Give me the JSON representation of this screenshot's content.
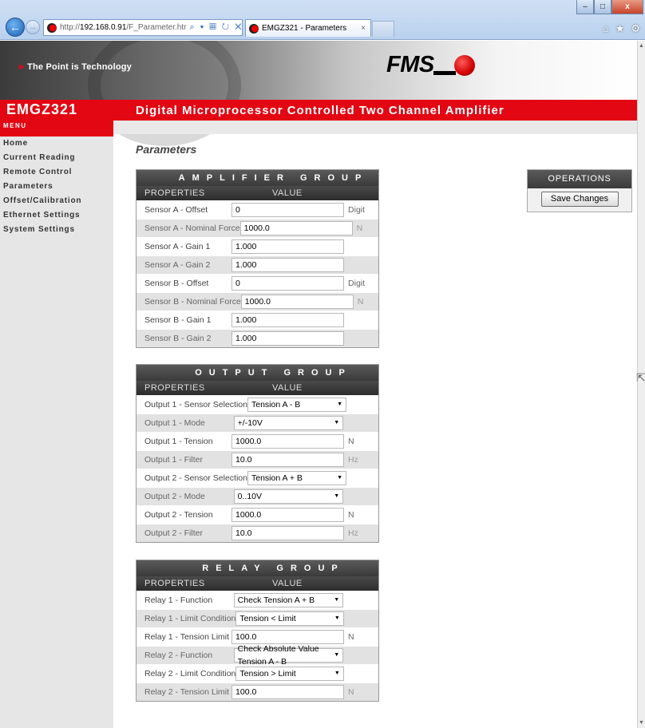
{
  "browser": {
    "url_prefix": "http://",
    "url_host": "192.168.0.91",
    "url_path": "/F_Parameter.htr",
    "address_icons": "⌕ ▾ ▦ ↻ ✕",
    "tab_title": "EMGZ321 - Parameters",
    "tab_close": "×",
    "win_min": "–",
    "win_max": "□",
    "win_close": "x",
    "toolbar_icons": [
      "⌂",
      "★",
      "⚙"
    ]
  },
  "header": {
    "tagline": "The Point is Technology",
    "logo_text": "FMS",
    "product": "EMGZ321",
    "subtitle": "Digital Microprocessor Controlled Two Channel Amplifier"
  },
  "sidebar": {
    "menu_title": "MENU",
    "items": [
      {
        "label": "Home"
      },
      {
        "label": "Current Reading"
      },
      {
        "label": "Remote Control"
      },
      {
        "label": "Parameters"
      },
      {
        "label": "Offset/Calibration"
      },
      {
        "label": "Ethernet Settings"
      },
      {
        "label": "System Settings"
      }
    ]
  },
  "main": {
    "title": "Parameters",
    "col_properties": "PROPERTIES",
    "col_value": "VALUE",
    "amplifier": {
      "title": "AMPLIFIER GROUP",
      "rows": [
        {
          "label": "Sensor A - Offset",
          "value": "0",
          "unit": "Digit"
        },
        {
          "label": "Sensor A - Nominal Force",
          "value": "1000.0",
          "unit": "N"
        },
        {
          "label": "Sensor A - Gain 1",
          "value": "1.000",
          "unit": ""
        },
        {
          "label": "Sensor A - Gain 2",
          "value": "1.000",
          "unit": ""
        },
        {
          "label": "Sensor B - Offset",
          "value": "0",
          "unit": "Digit"
        },
        {
          "label": "Sensor B - Nominal Force",
          "value": "1000.0",
          "unit": "N"
        },
        {
          "label": "Sensor B - Gain 1",
          "value": "1.000",
          "unit": ""
        },
        {
          "label": "Sensor B - Gain 2",
          "value": "1.000",
          "unit": ""
        }
      ]
    },
    "output": {
      "title": "OUTPUT GROUP",
      "rows": [
        {
          "label": "Output 1 - Sensor Selection",
          "value": "Tension A - B",
          "unit": ""
        },
        {
          "label": "Output 1 - Mode",
          "value": "+/-10V",
          "unit": ""
        },
        {
          "label": "Output 1 - Tension",
          "value": "1000.0",
          "unit": "N"
        },
        {
          "label": "Output 1 - Filter",
          "value": "10.0",
          "unit": "Hz"
        },
        {
          "label": "Output 2 - Sensor Selection",
          "value": "Tension A + B",
          "unit": ""
        },
        {
          "label": "Output 2 - Mode",
          "value": "0..10V",
          "unit": ""
        },
        {
          "label": "Output 2 - Tension",
          "value": "1000.0",
          "unit": "N"
        },
        {
          "label": "Output 2 - Filter",
          "value": "10.0",
          "unit": "Hz"
        }
      ]
    },
    "relay": {
      "title": "RELAY GROUP",
      "rows": [
        {
          "label": "Relay 1 - Function",
          "value": "Check Tension A + B",
          "unit": ""
        },
        {
          "label": "Relay 1 - Limit Condition",
          "value": "Tension < Limit",
          "unit": ""
        },
        {
          "label": "Relay 1 - Tension Limit",
          "value": "100.0",
          "unit": "N"
        },
        {
          "label": "Relay 2 - Function",
          "value": "Check Absolute Value Tension A - B",
          "unit": ""
        },
        {
          "label": "Relay 2 - Limit Condition",
          "value": "Tension > Limit",
          "unit": ""
        },
        {
          "label": "Relay 2 - Tension Limit",
          "value": "100.0",
          "unit": "N"
        }
      ]
    }
  },
  "operations": {
    "title": "OPERATIONS",
    "save_label": "Save Changes"
  },
  "colors": {
    "brand_red": "#e30613",
    "header_dark": "#3a3a3a",
    "sidebar_bg": "#e6e6e6"
  }
}
